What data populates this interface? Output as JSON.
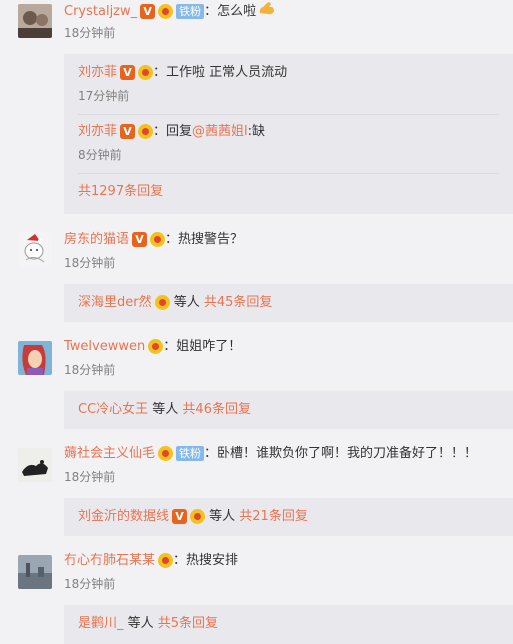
{
  "comments": [
    {
      "name": "Crystaljzw_",
      "tag": "铁粉",
      "text": "：怎么啦",
      "time": "18分钟前",
      "replies": [
        {
          "name": "刘亦菲",
          "text": "：工作啦 正常人员流动",
          "time": "17分钟前"
        },
        {
          "name": "刘亦菲",
          "text_prefix": "：回复",
          "mention": "@茜茜姐l",
          "text_suffix": ":缺",
          "time": "8分钟前"
        }
      ],
      "more": "共1297条回复"
    },
    {
      "name": "房东的猫语",
      "text": "：热搜警告？",
      "time": "18分钟前",
      "more_name": "深海里der然",
      "more_plain": " 等人 ",
      "more_count": "共45条回复"
    },
    {
      "name": "Twelvewwen",
      "text": "：姐姐咋了！",
      "time": "18分钟前",
      "more_name": "CC冷心女王",
      "more_plain": " 等人 ",
      "more_count": "共46条回复"
    },
    {
      "name": "薅社会主义仙毛",
      "tag": "铁粉",
      "text": "：卧槽！谁欺负你了啊！我的刀准备好了！！！",
      "time": "18分钟前",
      "more_name": "刘金沂的数据线",
      "more_plain": " 等人 ",
      "more_count": "共21条回复"
    },
    {
      "name": "冇心冇肺石某某",
      "text": "：热搜安排",
      "time": "18分钟前",
      "more_name": "是鹳川_",
      "more_plain": " 等人 ",
      "more_count": "共5条回复"
    }
  ],
  "icons": {
    "verified": "V",
    "yellow_badge": "vip-badge-icon",
    "emoji": "flexed-biceps"
  },
  "colors": {
    "name": "#eb7350",
    "background": "#f2f2f5",
    "reply_background": "#e9e9ed"
  }
}
